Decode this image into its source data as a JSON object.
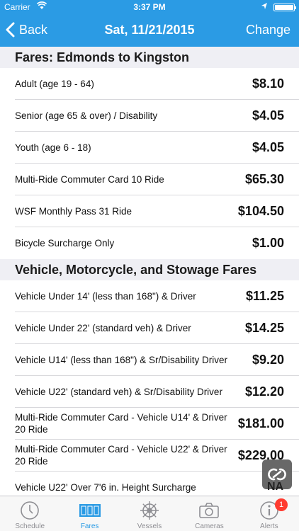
{
  "status_bar": {
    "carrier": "Carrier",
    "time": "3:37 PM"
  },
  "nav": {
    "back_label": "Back",
    "title": "Sat, 11/21/2015",
    "change_label": "Change"
  },
  "sections": [
    {
      "header": "Fares: Edmonds to Kingston",
      "rows": [
        {
          "label": "Adult (age 19 - 64)",
          "price": "$8.10"
        },
        {
          "label": "Senior (age 65 & over) / Disability",
          "price": "$4.05"
        },
        {
          "label": "Youth (age 6 - 18)",
          "price": "$4.05"
        },
        {
          "label": "Multi-Ride Commuter Card 10 Ride",
          "price": "$65.30"
        },
        {
          "label": "WSF Monthly Pass 31 Ride",
          "price": "$104.50"
        },
        {
          "label": "Bicycle Surcharge Only",
          "price": "$1.00"
        }
      ]
    },
    {
      "header": "Vehicle, Motorcycle, and Stowage Fares",
      "rows": [
        {
          "label": "Vehicle Under 14' (less than 168\") & Driver",
          "price": "$11.25"
        },
        {
          "label": "Vehicle Under 22' (standard veh) & Driver",
          "price": "$14.25"
        },
        {
          "label": "Vehicle U14' (less than 168\") & Sr/Disability Driver",
          "price": "$9.20"
        },
        {
          "label": "Vehicle U22' (standard veh) & Sr/Disability Driver",
          "price": "$12.20"
        },
        {
          "label": "Multi-Ride Commuter Card - Vehicle U14' & Driver 20 Ride",
          "price": "$181.00"
        },
        {
          "label": "Multi-Ride Commuter Card - Vehicle U22' & Driver 20 Ride",
          "price": "$229.00"
        },
        {
          "label": "Vehicle U22' Over 7'6 in. Height Surcharge",
          "price": ""
        }
      ]
    }
  ],
  "floating": {
    "text": "NA"
  },
  "tabs": [
    {
      "label": "Schedule",
      "icon": "clock-icon"
    },
    {
      "label": "Fares",
      "icon": "tickets-icon"
    },
    {
      "label": "Vessels",
      "icon": "ship-wheel-icon"
    },
    {
      "label": "Cameras",
      "icon": "camera-icon"
    },
    {
      "label": "Alerts",
      "icon": "info-icon"
    }
  ],
  "alerts_badge": "1",
  "colors": {
    "accent": "#2b9be4",
    "section_bg": "#efeff4",
    "badge": "#ff3b30"
  }
}
